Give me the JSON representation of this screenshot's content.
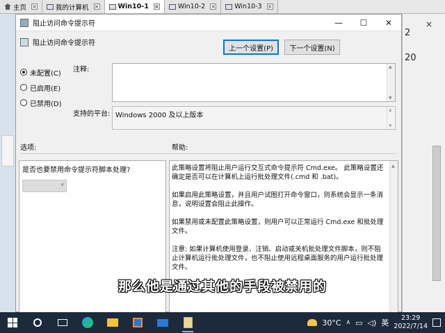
{
  "vm_tabs": [
    {
      "label": "主页",
      "active": false
    },
    {
      "label": "我的计算机",
      "active": false
    },
    {
      "label": "Win10-1",
      "active": true
    },
    {
      "label": "Win10-2",
      "active": false
    },
    {
      "label": "Win10-3",
      "active": false
    }
  ],
  "background": {
    "num_top": "2",
    "num_mid": "20"
  },
  "dialog": {
    "title": "阻止访问命令提示符",
    "policy_name": "阻止访问命令提示符",
    "prev_button": "上一个设置(P)",
    "next_button": "下一个设置(N)",
    "radios": [
      {
        "label": "未配置(C)",
        "checked": true
      },
      {
        "label": "已启用(E)",
        "checked": false
      },
      {
        "label": "已禁用(D)",
        "checked": false
      }
    ],
    "comment_label": "注释:",
    "comment_value": "",
    "platform_label": "支持的平台:",
    "platform_value": "Windows 2000 及以上版本",
    "options_label": "选项:",
    "help_label": "帮助:",
    "option_question": "是否也要禁用命令提示符脚本处理?",
    "option_combo_value": "",
    "help_paragraphs": [
      "此策略设置将阻止用户运行交互式命令提示符 Cmd.exe。 此策略设置还确定是否可以在计算机上运行批处理文件(.cmd 和 .bat)。",
      "如果启用此策略设置，并且用户试图打开命令窗口，则系统会显示一条消息，说明设置会阻止此操作。",
      "如果禁用或未配置此策略设置，则用户可以正常运行 Cmd.exe 和批处理文件。",
      "注意: 如果计算机使用登录、注销、启动或关机批处理文件脚本，则不阻止计算机运行批处理文件，也不阻止使用远程桌面服务的用户运行批处理文件。"
    ]
  },
  "subtitle": "那么他是通过其他的手段被禁用的",
  "taskbar": {
    "temperature": "30°C",
    "ime": "英",
    "time": "23:29",
    "date": "2022/7/14"
  }
}
